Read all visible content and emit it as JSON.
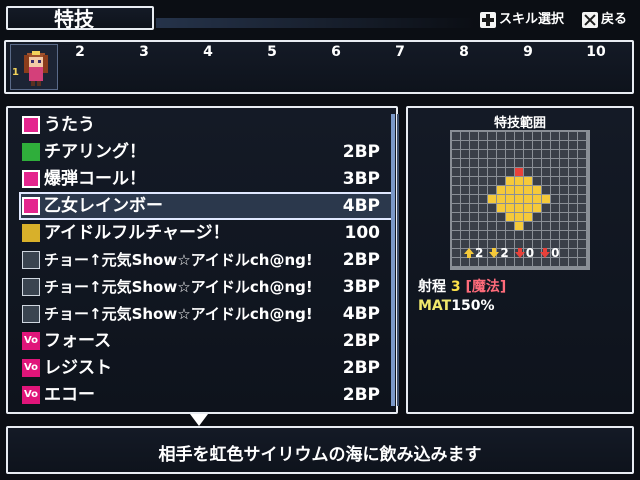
{
  "header": {
    "title": "特技",
    "hints": [
      {
        "icon": "dpad-icon",
        "label": "スキル選択"
      },
      {
        "icon": "x-button-icon",
        "label": "戻る"
      }
    ]
  },
  "party": {
    "active_slot": "1",
    "slots": [
      "2",
      "3",
      "4",
      "5",
      "6",
      "7",
      "8",
      "9",
      "10"
    ]
  },
  "skills": [
    {
      "icon": "music-note-icon",
      "name": "うたう",
      "cost": ""
    },
    {
      "icon": "plus-icon",
      "name": "チアリング！",
      "cost": "2BP"
    },
    {
      "icon": "pink-square-icon",
      "name": "爆弾コール！",
      "cost": "3BP"
    },
    {
      "icon": "pink-square-icon",
      "name": "乙女レインボー",
      "cost": "4BP",
      "selected": true
    },
    {
      "icon": "star-icon",
      "name": "アイドルフルチャージ！",
      "cost": "100"
    },
    {
      "icon": "song-1-icon",
      "name": "チョー↑元気Show☆アイドルch@ng!",
      "cost": "2BP"
    },
    {
      "icon": "song-2-icon",
      "name": "チョー↑元気Show☆アイドルch@ng!",
      "cost": "3BP"
    },
    {
      "icon": "song-3-icon",
      "name": "チョー↑元気Show☆アイドルch@ng!",
      "cost": "4BP"
    },
    {
      "icon": "vo-icon",
      "name": "フォース",
      "cost": "2BP"
    },
    {
      "icon": "vo-icon",
      "name": "レジスト",
      "cost": "2BP"
    },
    {
      "icon": "vo-icon",
      "name": "エコー",
      "cost": "2BP"
    }
  ],
  "range_panel": {
    "title": "特技範囲",
    "effects": [
      {
        "icon": "up-arrow-yellow-icon",
        "value": "2"
      },
      {
        "icon": "down-arrow-yellow-icon",
        "value": "2"
      },
      {
        "icon": "down-arrow-red-icon",
        "value": "0"
      },
      {
        "icon": "down-arrow-red-icon",
        "value": "0"
      }
    ],
    "range_label": "射程",
    "range_value": "3",
    "range_type": "[魔法]",
    "stat_label": "MAT",
    "stat_value": "150%",
    "colors": {
      "yellow": "#f5c93a",
      "red": "#e8413a",
      "grid": "#3a3f48"
    }
  },
  "description": "相手を虹色サイリウムの海に飲み込みます"
}
